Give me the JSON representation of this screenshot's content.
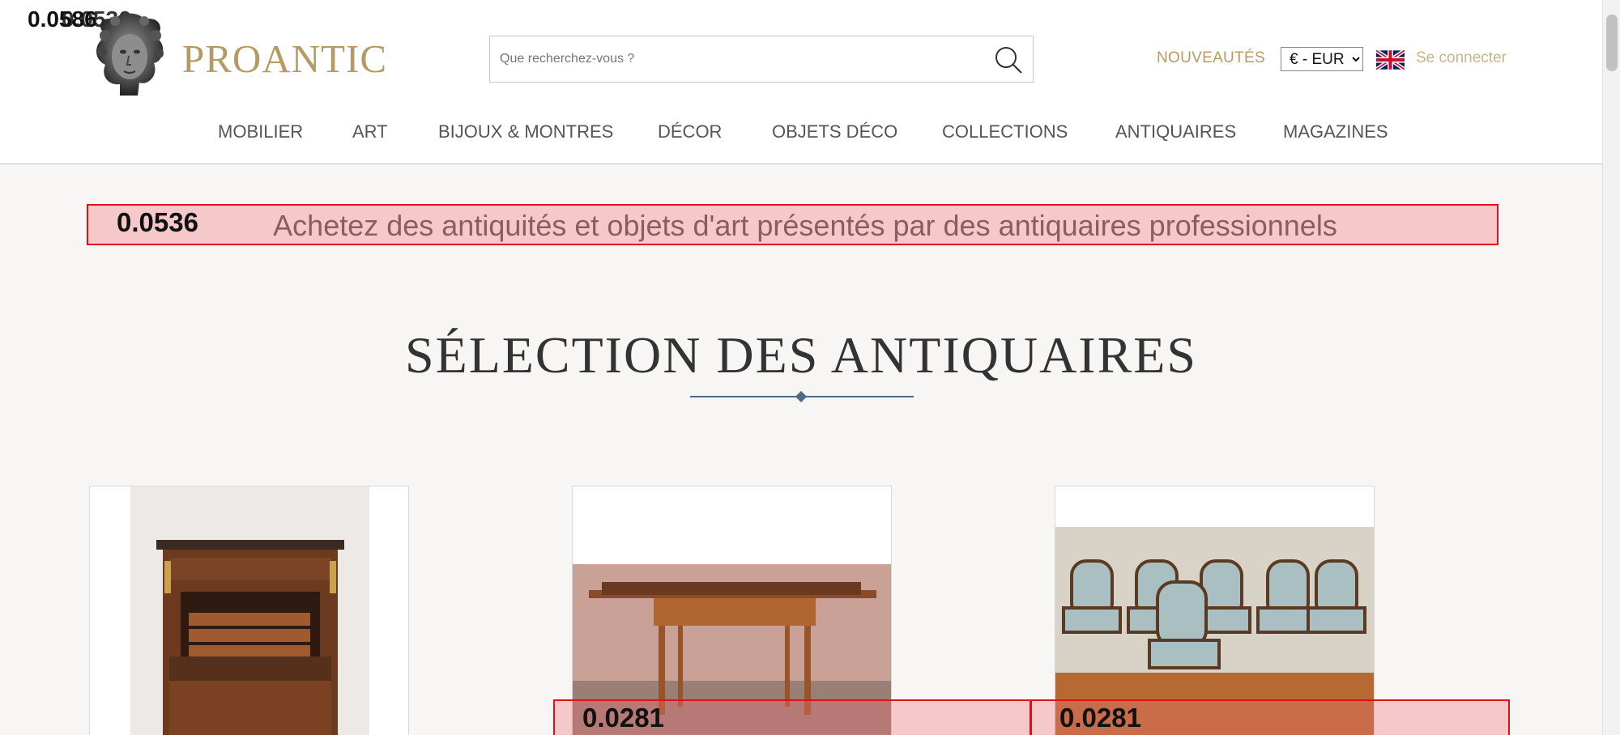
{
  "header": {
    "brand": "PROANTIC",
    "search_placeholder": "Que recherchez-vous ?",
    "new_label": "NOUVEAUTÉS",
    "currency_selected": "€ - EUR",
    "login_label": "Se connecter"
  },
  "nav": {
    "items": [
      "MOBILIER",
      "ART",
      "BIJOUX & MONTRES",
      "DÉCOR",
      "OBJETS DÉCO",
      "COLLECTIONS",
      "ANTIQUAIRES",
      "MAGAZINES"
    ]
  },
  "tagline": "Achetez des antiquités et objets d'art présentés par des antiquaires professionnels",
  "section_title": "SÉLECTION DES ANTIQUAIRES",
  "annotations": {
    "top_left_a": "0.0586",
    "top_left_b": "0.0536",
    "tagline_score": "0.0536",
    "card2_score": "0.0281",
    "card3_score": "0.0281"
  },
  "colors": {
    "brand_gold": "#b59a63",
    "accent_blue": "#4f6b87",
    "annotation_red": "#e0101a"
  },
  "icons": [
    "medusa-head-logo-icon",
    "search-icon",
    "uk-flag-icon"
  ]
}
